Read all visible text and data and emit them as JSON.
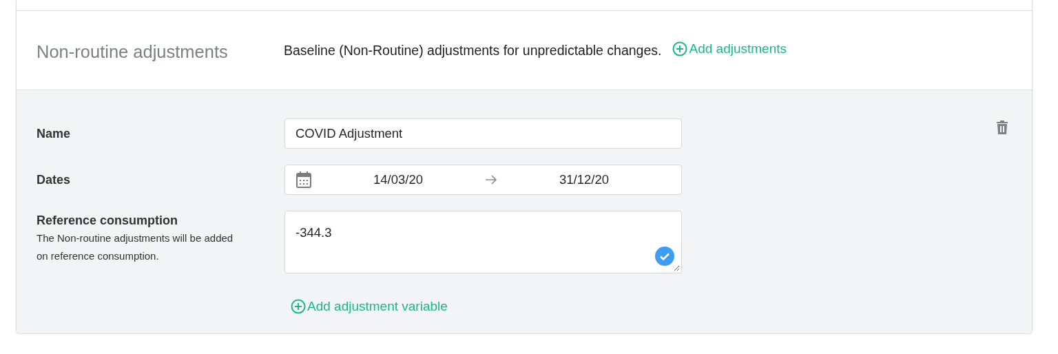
{
  "section": {
    "title": "Non-routine adjustments",
    "description": "Baseline (Non-Routine) adjustments for unpredictable changes.",
    "add_link": "Add adjustments"
  },
  "adjustment": {
    "name_label": "Name",
    "name_value": "COVID Adjustment",
    "dates_label": "Dates",
    "start_date": "14/03/20",
    "end_date": "31/12/20",
    "reference_label": "Reference consumption",
    "reference_help": "The Non-routine adjustments will be added on reference consumption.",
    "reference_value": "-344.3",
    "validated": true,
    "add_variable_link": "Add adjustment variable"
  }
}
